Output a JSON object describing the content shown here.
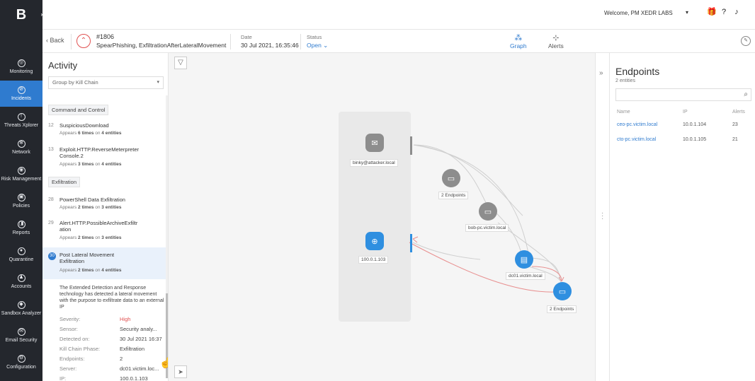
{
  "nav": {
    "logo": "B",
    "items": [
      {
        "label": "Monitoring",
        "icon": "monitoring-icon"
      },
      {
        "label": "Incidents",
        "icon": "incidents-icon"
      },
      {
        "label": "Threats Xplorer",
        "icon": "threats-icon"
      },
      {
        "label": "Network",
        "icon": "network-icon"
      },
      {
        "label": "Risk Management",
        "icon": "risk-icon"
      },
      {
        "label": "Policies",
        "icon": "policies-icon"
      },
      {
        "label": "Reports",
        "icon": "reports-icon"
      },
      {
        "label": "Quarantine",
        "icon": "quarantine-icon"
      },
      {
        "label": "Accounts",
        "icon": "accounts-icon"
      },
      {
        "label": "Sandbox Analyzer",
        "icon": "sandbox-icon"
      },
      {
        "label": "Email Security",
        "icon": "email-icon"
      },
      {
        "label": "Configuration",
        "icon": "configuration-icon"
      }
    ]
  },
  "topbar": {
    "welcome": "Welcome, PM XEDR LABS"
  },
  "header": {
    "back": "Back",
    "incident_number": "#1806",
    "incident_name": "SpearPhishing, ExfiltrationAfterLateralMovement",
    "date_label": "Date",
    "date_value": "30 Jul 2021, 16:35:46",
    "status_label": "Status",
    "status_value": "Open",
    "tab_graph": "Graph",
    "tab_alerts": "Alerts"
  },
  "activity": {
    "title": "Activity",
    "group_by": "Group by Kill Chain",
    "phase_command": "Command and Control",
    "phase_exfiltration": "Exfiltration",
    "items": [
      {
        "num": "12",
        "name": "SuspiciousDownload",
        "times": "6 times",
        "entities": "4 entities"
      },
      {
        "num": "13",
        "name": "Exploit.HTTP.ReverseMeterpreter Console.2",
        "times": "3 times",
        "entities": "4 entities"
      },
      {
        "num": "28",
        "name": "PowerShell Data Exfiltration",
        "times": "2 times",
        "entities": "3 entities"
      },
      {
        "num": "29",
        "name": "Alert.HTTP.PossibleArchiveExfiltration",
        "times": "2 times",
        "entities": "3 entities"
      },
      {
        "num": "30",
        "name": "Post Lateral Movement Exfiltration",
        "times": "2 times",
        "entities": "4 entities"
      }
    ],
    "appears": "Appears",
    "on": "on",
    "description": "The Extended Detection and Response technology has detected a lateral movement with the purpose to exfiltrate data to an external IP",
    "details": [
      {
        "key": "Severity:",
        "value": "High"
      },
      {
        "key": "Sensor:",
        "value": "Security analy..."
      },
      {
        "key": "Detected on:",
        "value": "30 Jul 2021 16:37"
      },
      {
        "key": "Kill Chain Phase:",
        "value": "Exfiltration"
      },
      {
        "key": "Endpoints:",
        "value": "2"
      },
      {
        "key": "Server:",
        "value": "dc01.victim.loc..."
      },
      {
        "key": "IP:",
        "value": "100.0.1.103"
      }
    ]
  },
  "graph": {
    "nodes": {
      "attacker_email": "binky@attacker.local",
      "external_ip": "100.0.1.103",
      "endpoints_group_1": "2 Endpoints",
      "bob_pc": "bob-pc.victim.local",
      "dc01": "dc01.victim.local",
      "endpoints_group_2": "2 Endpoints"
    }
  },
  "endpoints": {
    "title": "Endpoints",
    "count": "2 entities",
    "col_name": "Name",
    "col_ip": "IP",
    "col_alerts": "Alerts",
    "rows": [
      {
        "name": "ceo-pc.victim.local",
        "ip": "10.0.1.104",
        "alerts": "23"
      },
      {
        "name": "cto-pc.victim.local",
        "ip": "10.0.1.105",
        "alerts": "21"
      }
    ]
  },
  "colors": {
    "accent": "#2f7bcf",
    "nav_bg": "#24272d",
    "severity_high": "#e05050"
  }
}
